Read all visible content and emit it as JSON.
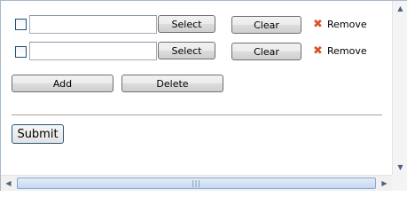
{
  "rows": [
    {
      "input_value": "",
      "select_label": "Select",
      "clear_label": "Clear",
      "remove_label": "Remove",
      "checked": false
    },
    {
      "input_value": "",
      "select_label": "Select",
      "clear_label": "Clear",
      "remove_label": "Remove",
      "checked": false
    }
  ],
  "actions": {
    "add_label": "Add",
    "delete_label": "Delete"
  },
  "form": {
    "submit_label": "Submit"
  },
  "icons": {
    "remove": "close-x-icon",
    "scroll_up": "arrow-up-icon",
    "scroll_down": "arrow-down-icon",
    "scroll_left": "arrow-left-icon",
    "scroll_right": "arrow-right-icon"
  },
  "colors": {
    "remove_icon": "#d9542f",
    "scrollbar_thumb": "#c5d8f2"
  }
}
